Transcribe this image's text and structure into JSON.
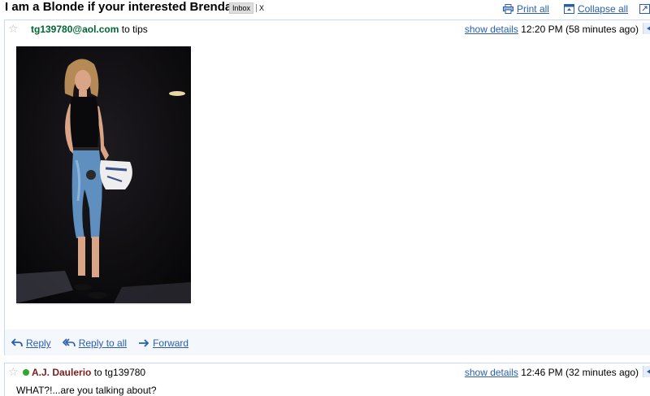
{
  "thread": {
    "subject": "I am a Blonde if your interested Brenda",
    "label": "Inbox",
    "label_remove": "X",
    "print_all": "Print all",
    "collapse_all": "Collapse all"
  },
  "message1": {
    "sender": "tg139780@aol.com",
    "to": "to tips",
    "show_details": "show details",
    "time": "12:20 PM (58 minutes ago)",
    "actions": {
      "reply": "Reply",
      "reply_all": "Reply to all",
      "forward": "Forward"
    }
  },
  "message2": {
    "sender": "A.J. Daulerio",
    "to": "to tg139780",
    "show_details": "show details",
    "time": "12:46 PM (32 minutes ago)",
    "snippet": "WHAT?!...are you talking about?"
  },
  "colors": {
    "link": "#2a5db0",
    "sender1": "#006633",
    "sender2": "#7a1f1f",
    "presence": "#2ea82e",
    "border": "#c3d9ff"
  },
  "icons": [
    "star-icon",
    "print-icon",
    "collapse-icon",
    "reply-icon",
    "reply-all-icon",
    "forward-icon",
    "presence-icon"
  ]
}
